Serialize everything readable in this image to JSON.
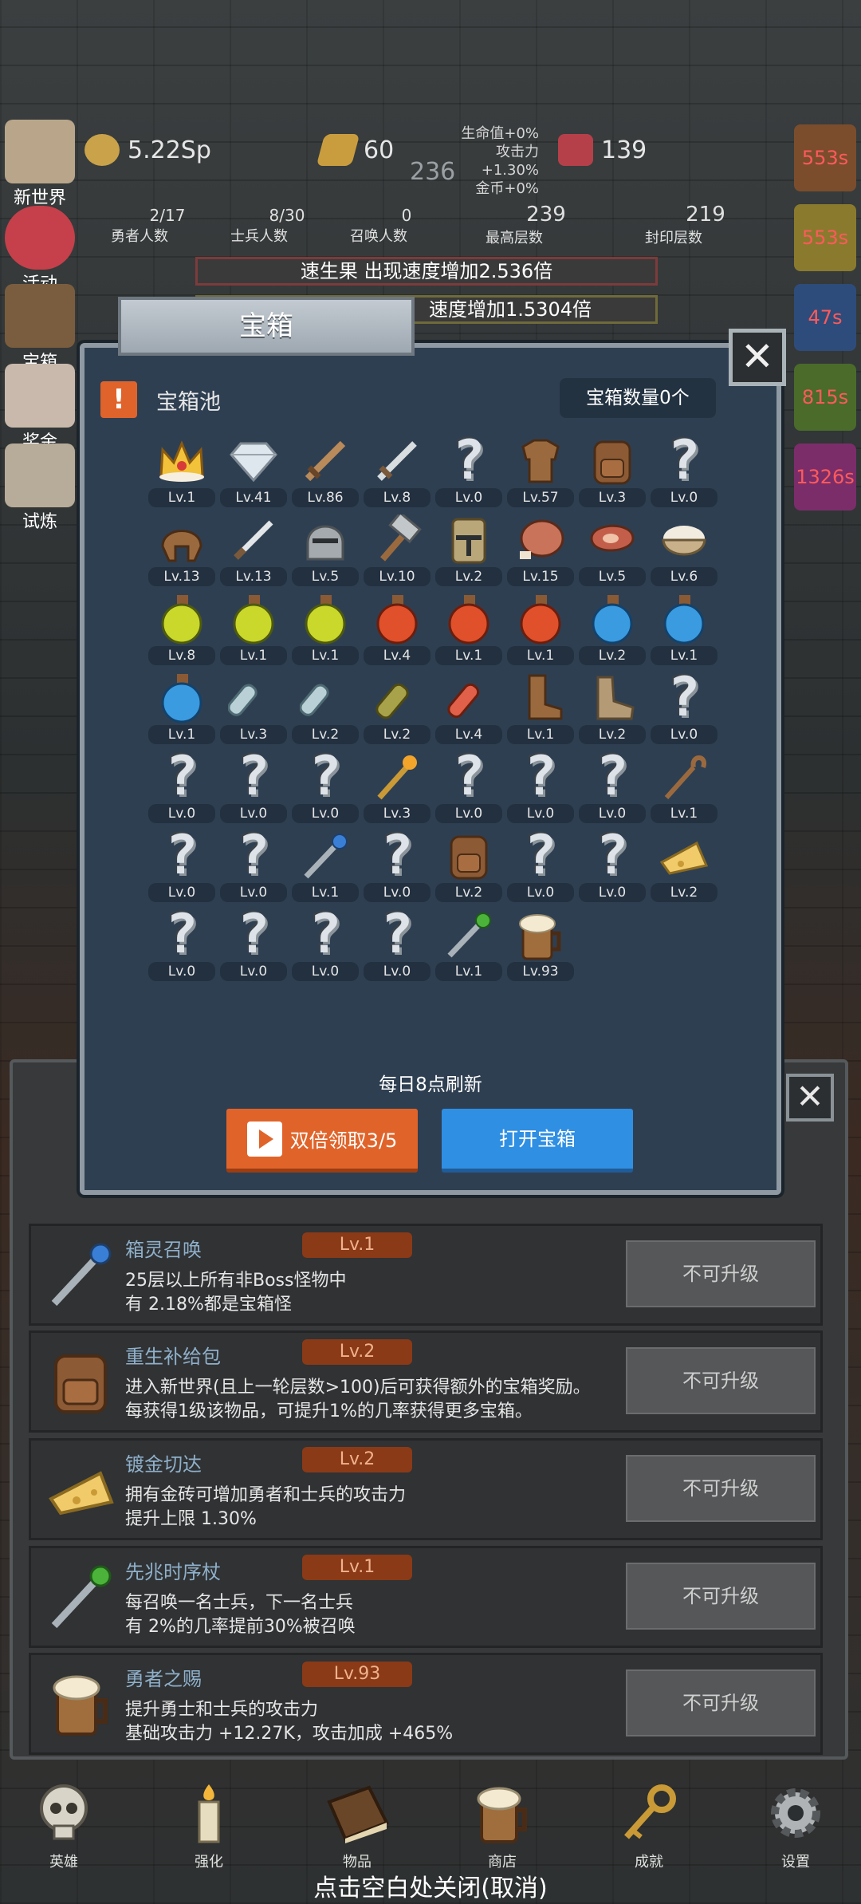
{
  "hud": {
    "gold": "5.22Sp",
    "bars": "60",
    "center_num": "236",
    "gems": "139",
    "buffs": [
      "生命值+0%",
      "攻击力+1.30%",
      "金币+0%"
    ],
    "stats": [
      {
        "value": "2/17",
        "label": "勇者人数"
      },
      {
        "value": "8/30",
        "label": "士兵人数"
      },
      {
        "value": "0",
        "label": "召唤人数"
      },
      {
        "value": "239",
        "label": "最高层数"
      },
      {
        "value": "219",
        "label": "封印层数"
      }
    ],
    "banner1": "速生果 出现速度增加2.536倍",
    "banner2": "速度增加1.5304倍",
    "side_menu": [
      "新世界",
      "活动",
      "宝箱",
      "奖金",
      "试炼"
    ],
    "timers": [
      "553s",
      "553s",
      "47s",
      "815s",
      "1326s"
    ]
  },
  "modal": {
    "title": "宝箱",
    "pool_label": "宝箱池",
    "count_label": "宝箱数量0个",
    "refresh_note": "每日8点刷新",
    "double_button": "双倍领取3/5",
    "open_button": "打开宝箱",
    "items": [
      {
        "icon": "crown",
        "level": "Lv.1"
      },
      {
        "icon": "diamond",
        "level": "Lv.41"
      },
      {
        "icon": "wooden-sword",
        "level": "Lv.86"
      },
      {
        "icon": "iron-sword",
        "level": "Lv.8"
      },
      {
        "icon": "unknown",
        "level": "Lv.0"
      },
      {
        "icon": "leather-armor",
        "level": "Lv.57"
      },
      {
        "icon": "backpack",
        "level": "Lv.3"
      },
      {
        "icon": "unknown",
        "level": "Lv.0"
      },
      {
        "icon": "leather-helmet",
        "level": "Lv.13"
      },
      {
        "icon": "dagger",
        "level": "Lv.13"
      },
      {
        "icon": "knight-helmet",
        "level": "Lv.5"
      },
      {
        "icon": "hammer",
        "level": "Lv.10"
      },
      {
        "icon": "great-helm",
        "level": "Lv.2"
      },
      {
        "icon": "ham",
        "level": "Lv.15"
      },
      {
        "icon": "steak",
        "level": "Lv.5"
      },
      {
        "icon": "rice-bowl",
        "level": "Lv.6"
      },
      {
        "icon": "yellow-potion",
        "level": "Lv.8"
      },
      {
        "icon": "yellow-potion",
        "level": "Lv.1"
      },
      {
        "icon": "yellow-potion",
        "level": "Lv.1"
      },
      {
        "icon": "red-potion",
        "level": "Lv.4"
      },
      {
        "icon": "red-potion",
        "level": "Lv.1"
      },
      {
        "icon": "red-potion",
        "level": "Lv.1"
      },
      {
        "icon": "blue-potion",
        "level": "Lv.2"
      },
      {
        "icon": "blue-potion",
        "level": "Lv.1"
      },
      {
        "icon": "blue-potion",
        "level": "Lv.1"
      },
      {
        "icon": "vial",
        "level": "Lv.3"
      },
      {
        "icon": "vial",
        "level": "Lv.2"
      },
      {
        "icon": "wine-bottle",
        "level": "Lv.2"
      },
      {
        "icon": "red-vial",
        "level": "Lv.4"
      },
      {
        "icon": "boot",
        "level": "Lv.1"
      },
      {
        "icon": "shoe",
        "level": "Lv.2"
      },
      {
        "icon": "unknown",
        "level": "Lv.0"
      },
      {
        "icon": "unknown",
        "level": "Lv.0"
      },
      {
        "icon": "unknown",
        "level": "Lv.0"
      },
      {
        "icon": "unknown",
        "level": "Lv.0"
      },
      {
        "icon": "torch-staff",
        "level": "Lv.3"
      },
      {
        "icon": "unknown",
        "level": "Lv.0"
      },
      {
        "icon": "unknown",
        "level": "Lv.0"
      },
      {
        "icon": "unknown",
        "level": "Lv.0"
      },
      {
        "icon": "crook-staff",
        "level": "Lv.1"
      },
      {
        "icon": "unknown",
        "level": "Lv.0"
      },
      {
        "icon": "unknown",
        "level": "Lv.0"
      },
      {
        "icon": "blue-wand",
        "level": "Lv.1"
      },
      {
        "icon": "unknown",
        "level": "Lv.0"
      },
      {
        "icon": "backpack",
        "level": "Lv.2"
      },
      {
        "icon": "unknown",
        "level": "Lv.0"
      },
      {
        "icon": "unknown",
        "level": "Lv.0"
      },
      {
        "icon": "cheese",
        "level": "Lv.2"
      },
      {
        "icon": "unknown",
        "level": "Lv.0"
      },
      {
        "icon": "unknown",
        "level": "Lv.0"
      },
      {
        "icon": "unknown",
        "level": "Lv.0"
      },
      {
        "icon": "unknown",
        "level": "Lv.0"
      },
      {
        "icon": "green-wand",
        "level": "Lv.1"
      },
      {
        "icon": "ale-mug",
        "level": "Lv.93"
      }
    ]
  },
  "list": [
    {
      "icon": "blue-wand",
      "name": "箱灵召唤",
      "level": "Lv.1",
      "lines": [
        "25层以上所有非Boss怪物中",
        "有 2.18%都是宝箱怪"
      ],
      "button": "不可升级"
    },
    {
      "icon": "backpack",
      "name": "重生补给包",
      "level": "Lv.2",
      "lines": [
        "进入新世界(且上一轮层数>100)后可获得额外的宝箱奖励。",
        "每获得1级该物品，可提升1%的几率获得更多宝箱。"
      ],
      "button": "不可升级"
    },
    {
      "icon": "cheese",
      "name": "镀金切达",
      "level": "Lv.2",
      "lines": [
        "拥有金砖可增加勇者和士兵的攻击力",
        "提升上限 1.30%"
      ],
      "button": "不可升级"
    },
    {
      "icon": "green-wand",
      "name": "先兆时序杖",
      "level": "Lv.1",
      "lines": [
        "每召唤一名士兵，下一名士兵",
        "有 2%的几率提前30%被召唤"
      ],
      "button": "不可升级"
    },
    {
      "icon": "ale-mug",
      "name": "勇者之赐",
      "level": "Lv.93",
      "lines": [
        "提升勇士和士兵的攻击力",
        "基础攻击力 +12.27K，攻击加成 +465%"
      ],
      "button": "不可升级"
    }
  ],
  "nav": [
    "英雄",
    "强化",
    "物品",
    "商店",
    "成就",
    "设置"
  ],
  "close_hint": "点击空白处关闭(取消)"
}
